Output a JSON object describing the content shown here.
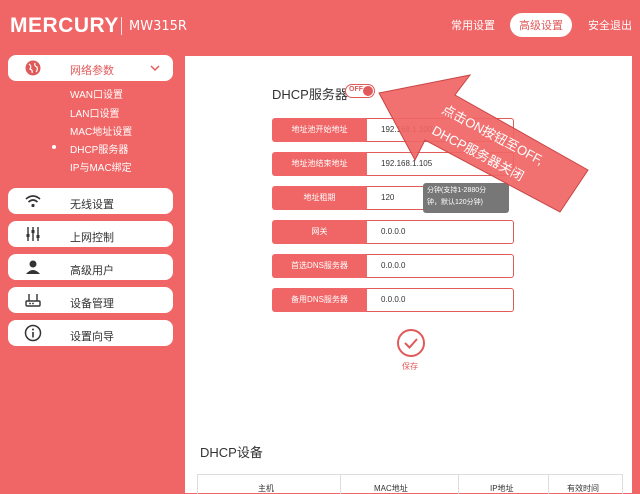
{
  "header": {
    "logo": "MERCURY",
    "model": "MW315R",
    "nav": [
      "常用设置",
      "高级设置",
      "安全退出"
    ]
  },
  "sidebar": {
    "network": {
      "label": "网络参数",
      "icon": "globe-icon"
    },
    "submenu": [
      "WAN口设置",
      "LAN口设置",
      "MAC地址设置",
      "DHCP服务器",
      "IP与MAC绑定"
    ],
    "groups": [
      {
        "label": "无线设置",
        "icon": "wifi-icon"
      },
      {
        "label": "上网控制",
        "icon": "sliders-icon"
      },
      {
        "label": "高级用户",
        "icon": "user-icon"
      },
      {
        "label": "设备管理",
        "icon": "router-icon"
      },
      {
        "label": "设置向导",
        "icon": "info-icon"
      }
    ]
  },
  "dhcp": {
    "title": "DHCP服务器",
    "toggle": "OFF",
    "rows": [
      {
        "label": "地址池开始地址",
        "value": "192.168.1.100"
      },
      {
        "label": "地址池结束地址",
        "value": "192.168.1.105"
      },
      {
        "label": "地址租期",
        "value": "120"
      },
      {
        "label": "网关",
        "value": "0.0.0.0"
      },
      {
        "label": "首选DNS服务器",
        "value": "0.0.0.0"
      },
      {
        "label": "备用DNS服务器",
        "value": "0.0.0.0"
      }
    ],
    "tooltip_line1": "分钟(支持1-2880分",
    "tooltip_line2": "钟，默认120分钟)",
    "save": "保存"
  },
  "devices": {
    "title": "DHCP设备",
    "columns": [
      "主机",
      "MAC地址",
      "IP地址",
      "有效时间"
    ]
  },
  "annotation": {
    "line1": "点击ON按钮至OFF,",
    "line2": "DHCP服务器关闭"
  },
  "colors": {
    "accent": "#f06565",
    "accent_dark": "#e05a5a"
  }
}
